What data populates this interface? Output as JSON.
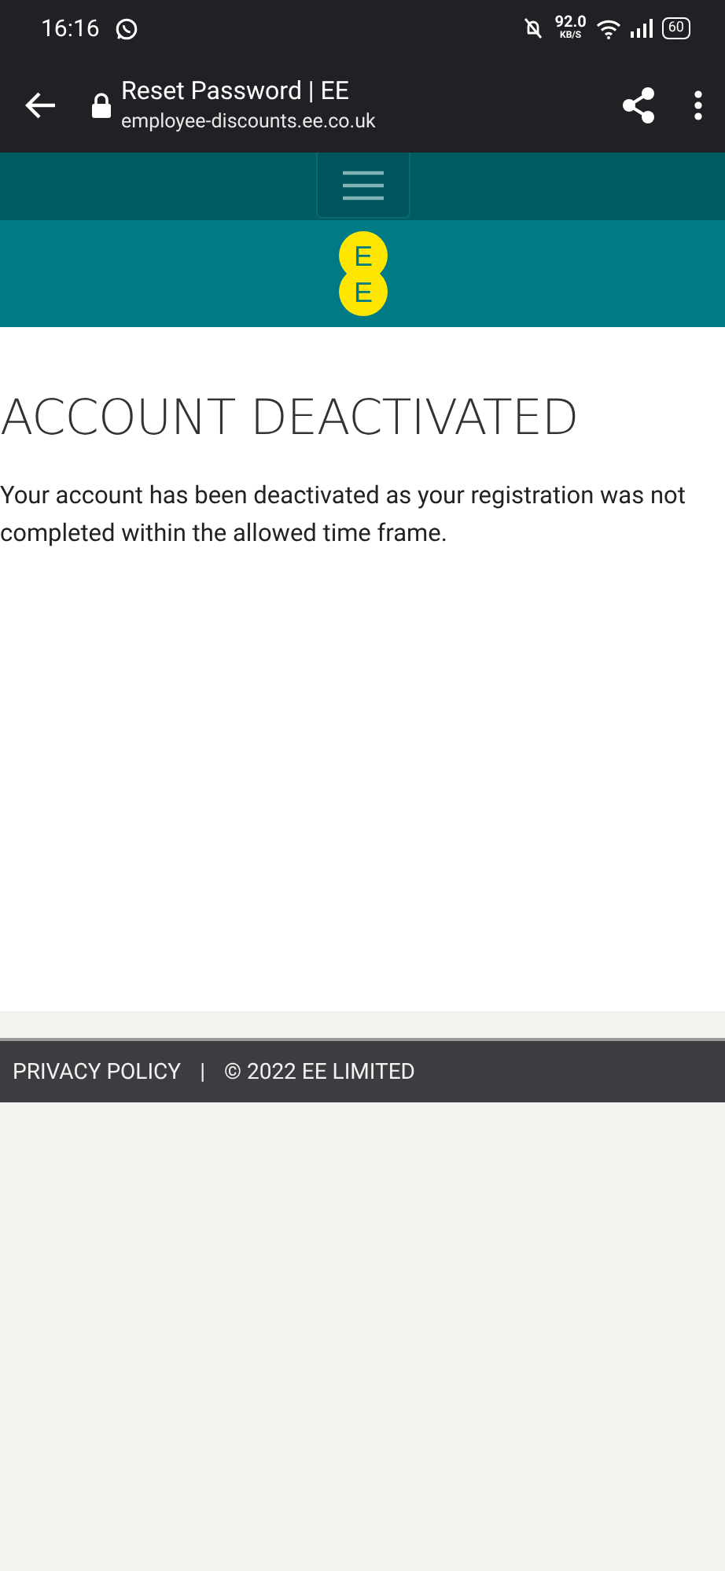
{
  "status_bar": {
    "time": "16:16",
    "speed": "92.0",
    "speed_unit": "KB/S",
    "battery": "60"
  },
  "browser": {
    "title": "Reset Password | EE",
    "url": "employee-discounts.ee.co.uk"
  },
  "logo": {
    "letters": [
      "E",
      "E"
    ]
  },
  "content": {
    "heading": "ACCOUNT DEACTIVATED",
    "message": "Your account has been deactivated as your registration was not completed within the allowed time frame."
  },
  "footer": {
    "links": [
      "PRIVACY POLICY"
    ],
    "separator": "|",
    "copyright": "© 2022 EE LIMITED"
  }
}
